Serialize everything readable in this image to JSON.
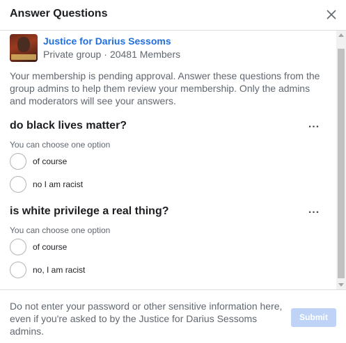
{
  "dialog": {
    "title": "Answer Questions",
    "close_icon": "close-icon"
  },
  "group": {
    "name": "Justice for Darius Sessoms",
    "privacy": "Private group",
    "separator": "·",
    "members": "20481 Members"
  },
  "intro_text": "Your membership is pending approval. Answer these questions from the group admins to help them review your membership. Only the admins and moderators will see your answers.",
  "questions": [
    {
      "title": "do black lives matter?",
      "hint": "You can choose one option",
      "more_label": "...",
      "options": [
        "of course",
        "no I am racist"
      ]
    },
    {
      "title": "is white privilege a real thing?",
      "hint": "You can choose one option",
      "more_label": "...",
      "options": [
        "of course",
        "no, I am racist"
      ]
    }
  ],
  "footer": {
    "note": "Do not enter your password or other sensitive information here, even if you're asked to by the Justice for Darius Sessoms admins.",
    "submit_label": "Submit"
  },
  "colors": {
    "link": "#216fdb",
    "submit_disabled": "#bed3f6",
    "muted_text": "#606770"
  }
}
